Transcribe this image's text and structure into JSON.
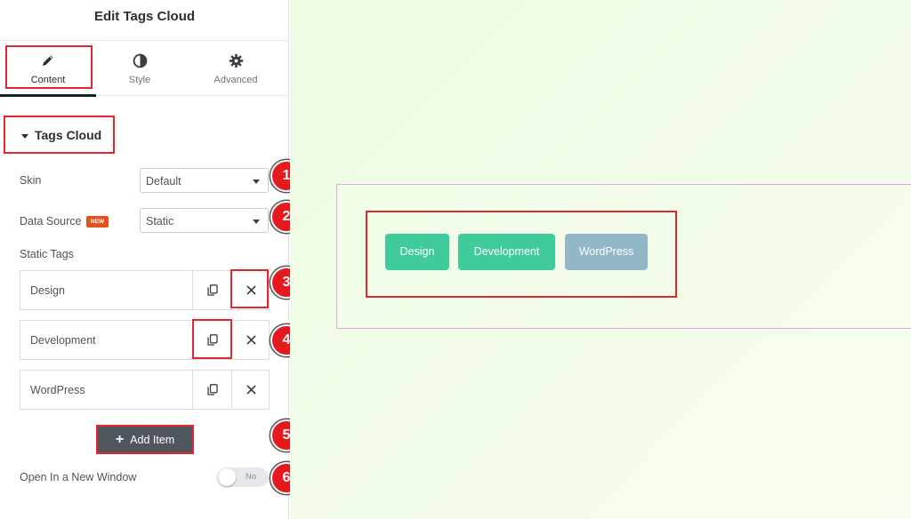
{
  "panel": {
    "title": "Edit Tags Cloud",
    "tabs": [
      {
        "label": "Content",
        "icon": "pencil-icon",
        "active": true
      },
      {
        "label": "Style",
        "icon": "contrast-icon",
        "active": false
      },
      {
        "label": "Advanced",
        "icon": "gear-icon",
        "active": false
      }
    ],
    "section": {
      "title": "Tags Cloud"
    },
    "skin": {
      "label": "Skin",
      "value": "Default"
    },
    "data_source": {
      "label": "Data Source",
      "badge": "NEW",
      "value": "Static"
    },
    "static_tags": {
      "label": "Static Tags",
      "items": [
        {
          "title": "Design"
        },
        {
          "title": "Development"
        },
        {
          "title": "WordPress"
        }
      ]
    },
    "add_item_label": "Add Item",
    "open_new_window": {
      "label": "Open In a New Window",
      "state": "No"
    }
  },
  "callouts": [
    "1",
    "2",
    "3",
    "4",
    "5",
    "6"
  ],
  "canvas": {
    "tags": [
      {
        "label": "Design",
        "color": "#3fcb9c"
      },
      {
        "label": "Development",
        "color": "#3fcb9c"
      },
      {
        "label": "WordPress",
        "color": "#92b7c8"
      }
    ]
  },
  "colors": {
    "highlight": "#e3262b",
    "callout": "#e51a1f",
    "widget_border": "#e5a7e2",
    "add_button": "#50565d"
  }
}
